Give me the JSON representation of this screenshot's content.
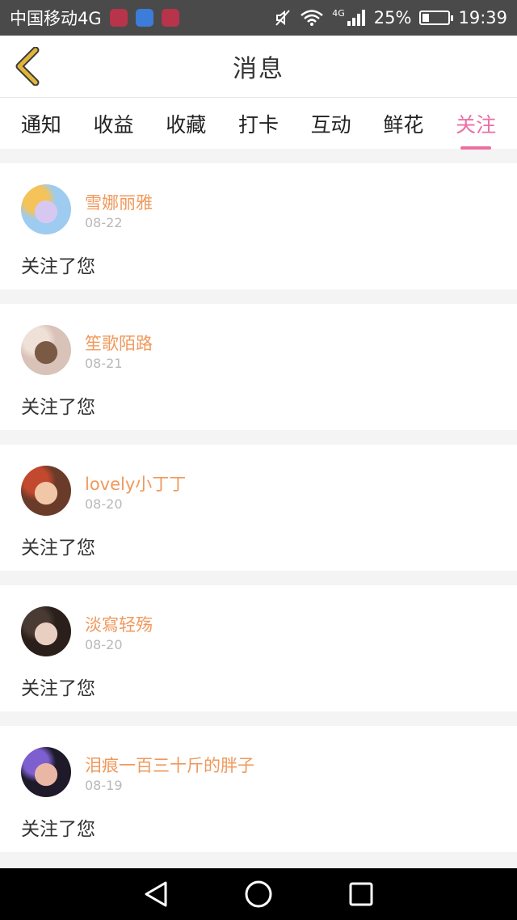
{
  "statusbar": {
    "carrier": "中国移动4G",
    "network_small": "4G",
    "battery_text": "25%",
    "battery_level": 0.25,
    "time": "19:39"
  },
  "header": {
    "title": "消息",
    "back_icon": "chevron-left-icon",
    "accent_color": "#e2b53a"
  },
  "tabs": [
    {
      "label": "通知",
      "active": false
    },
    {
      "label": "收益",
      "active": false
    },
    {
      "label": "收藏",
      "active": false
    },
    {
      "label": "打卡",
      "active": false
    },
    {
      "label": "互动",
      "active": false
    },
    {
      "label": "鲜花",
      "active": false
    },
    {
      "label": "关注",
      "active": true
    }
  ],
  "colors": {
    "active_tab": "#ec6fa3",
    "username": "#f0995c",
    "date": "#b8b8b8"
  },
  "messages": [
    {
      "name": "雪娜丽雅",
      "date": "08-22",
      "action": "关注了您",
      "avatar_colors": [
        "#9ecbf0",
        "#d7c8f2",
        "#f4c35a"
      ]
    },
    {
      "name": "笙歌陌路",
      "date": "08-21",
      "action": "关注了您",
      "avatar_colors": [
        "#d9c2b8",
        "#7a5a45",
        "#efe0d8"
      ]
    },
    {
      "name": "lovely小丁丁",
      "date": "08-20",
      "action": "关注了您",
      "avatar_colors": [
        "#6b3b2a",
        "#f1c7a8",
        "#c2482e"
      ]
    },
    {
      "name": "淡寫轻殇",
      "date": "08-20",
      "action": "关注了您",
      "avatar_colors": [
        "#2a1f1a",
        "#e8cfc2",
        "#4a3a34"
      ]
    },
    {
      "name": "泪痕一百三十斤的胖子",
      "date": "08-19",
      "action": "关注了您",
      "avatar_colors": [
        "#1e1a2a",
        "#e9b7a4",
        "#7d5fd0"
      ]
    }
  ],
  "navbar": {
    "back": "triangle-back-icon",
    "home": "circle-home-icon",
    "recent": "square-recent-icon"
  }
}
